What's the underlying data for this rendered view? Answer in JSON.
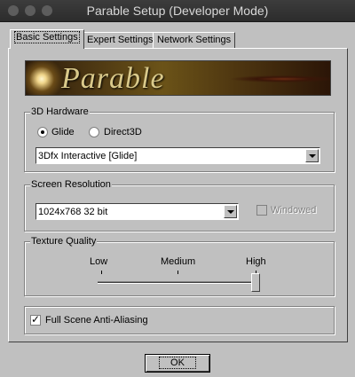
{
  "window": {
    "title": "Parable Setup (Developer Mode)"
  },
  "tabs": [
    {
      "label": "Basic Settings",
      "active": true
    },
    {
      "label": "Expert Settings",
      "active": false
    },
    {
      "label": "Network Settings",
      "active": false
    }
  ],
  "banner": {
    "text": "Parable"
  },
  "hardware": {
    "label": "3D Hardware",
    "options": [
      {
        "label": "Glide",
        "checked": true
      },
      {
        "label": "Direct3D",
        "checked": false
      }
    ],
    "device": "3Dfx Interactive [Glide]"
  },
  "resolution": {
    "label": "Screen Resolution",
    "value": "1024x768 32 bit",
    "windowed_label": "Windowed",
    "windowed_checked": false,
    "windowed_enabled": false
  },
  "texture": {
    "label": "Texture Quality",
    "levels": [
      "Low",
      "Medium",
      "High"
    ],
    "selected": "High",
    "value": 1.0
  },
  "antialias": {
    "label": "Full Scene Anti-Aliasing",
    "checked": true
  },
  "ok_button": {
    "label": "OK"
  },
  "colors": {
    "face": "#c0c0c0",
    "titlebar": "#333333"
  }
}
